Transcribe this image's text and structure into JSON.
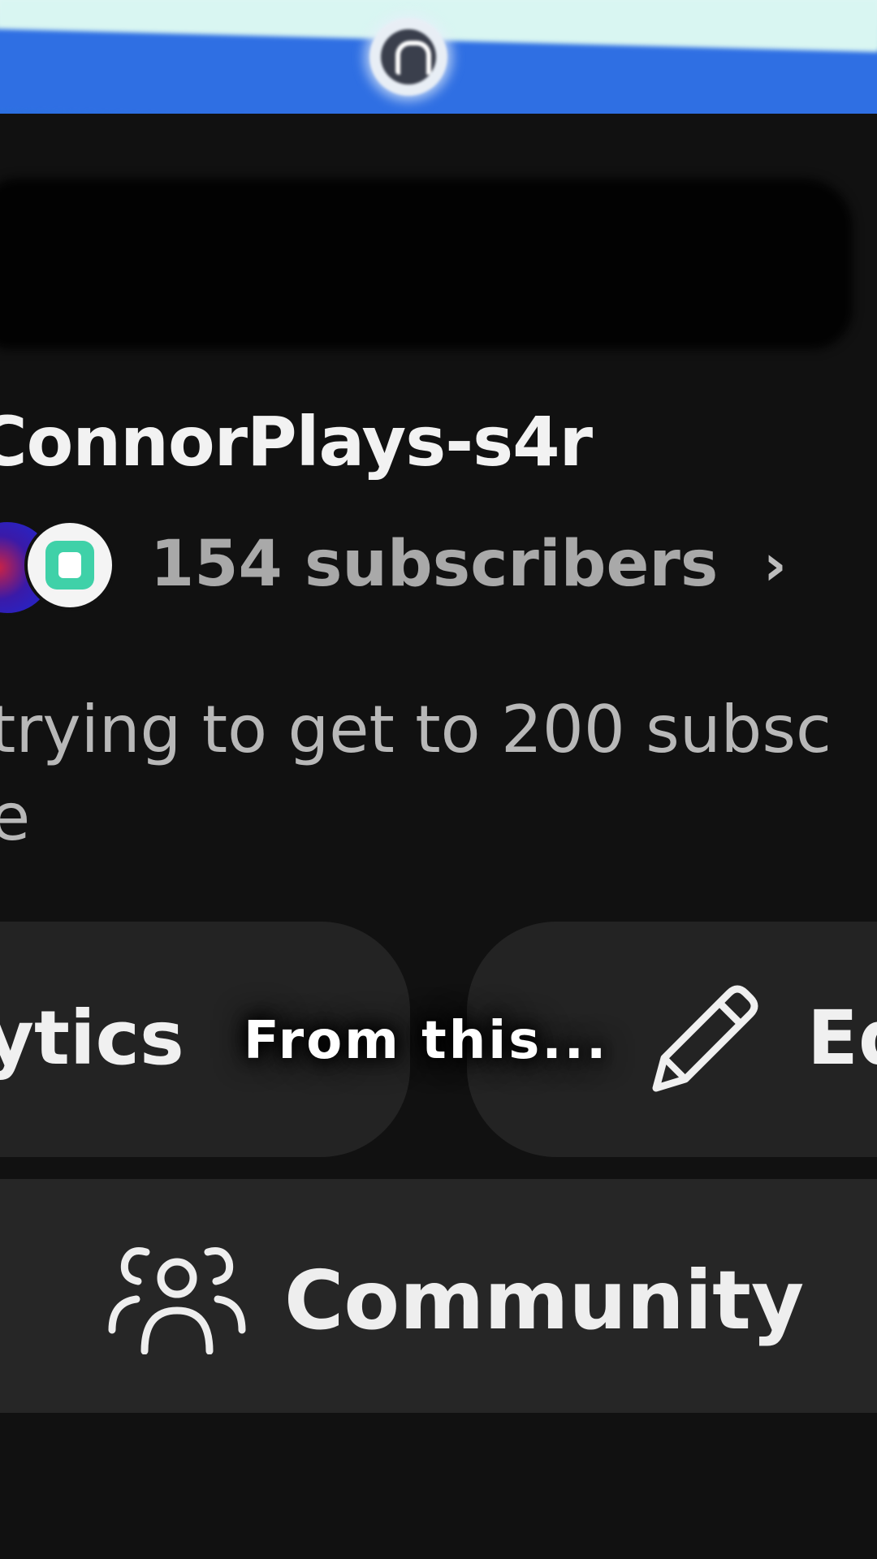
{
  "channel": {
    "name": "ConnorPlays-s4r",
    "subscribers": "154 subscribers",
    "subscribers_chevron": "›",
    "description_line1": "trying to get to 200 subsc",
    "description_line2": "e"
  },
  "actions": {
    "analytics_label": "ytics",
    "edit_label": "Ed",
    "community_label": "Community"
  },
  "caption": "From this...",
  "icons": {
    "banner_logo": "channel-logo-icon",
    "pencil": "pencil-icon",
    "community": "people-group-icon"
  },
  "colors": {
    "background": "#111111",
    "button": "#232323",
    "banner_blue": "#2f6fe3"
  }
}
